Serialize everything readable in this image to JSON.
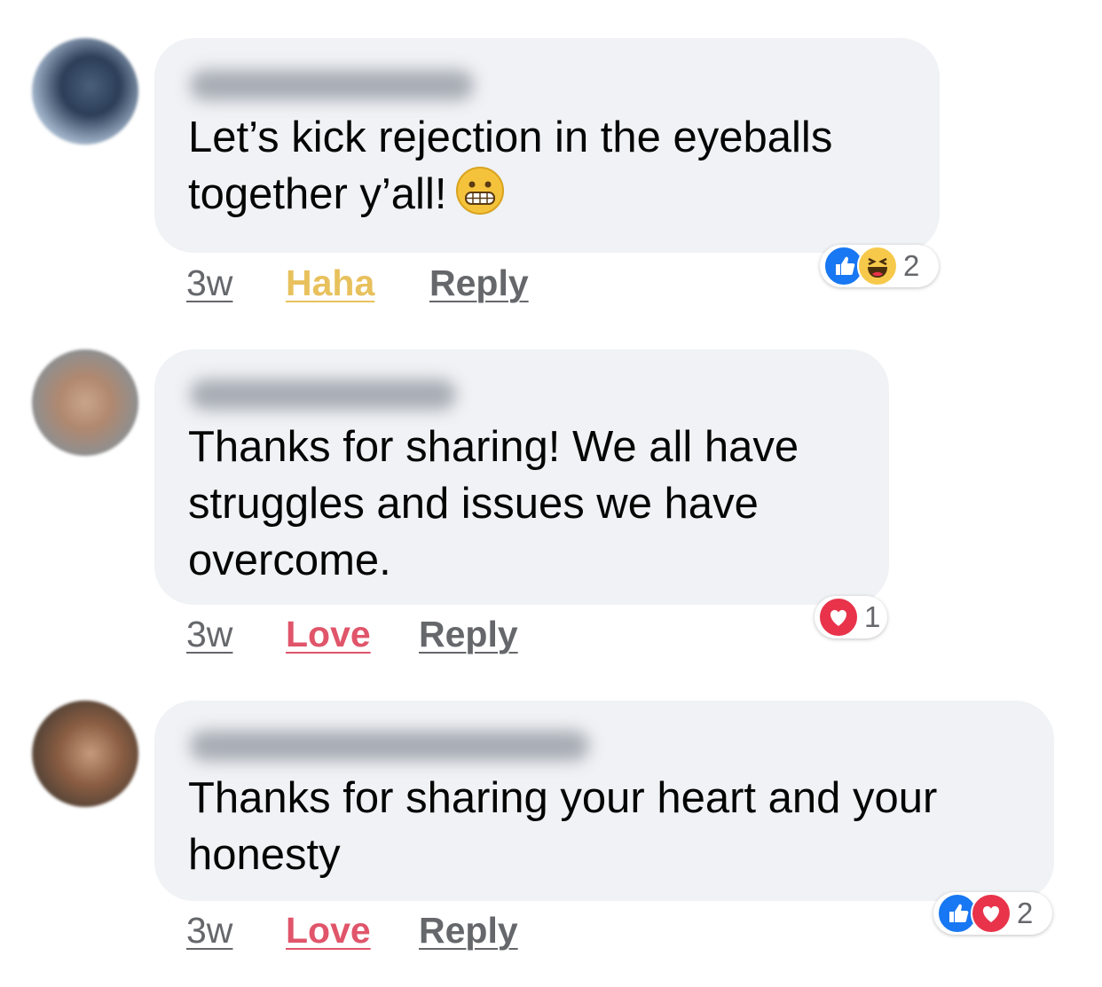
{
  "comments": [
    {
      "text_line1": "Let’s kick rejection in the eyeballs",
      "text_line2": "together y’all!",
      "inline_emoji": "grimacing-face",
      "time": "3w",
      "reaction_label": "Haha",
      "reply_label": "Reply",
      "reactions": [
        "like",
        "haha"
      ],
      "reaction_count": "2"
    },
    {
      "text": "Thanks for sharing! We all have struggles and issues we have overcome.",
      "time": "3w",
      "reaction_label": "Love",
      "reply_label": "Reply",
      "reactions": [
        "love"
      ],
      "reaction_count": "1"
    },
    {
      "text": "Thanks for sharing your heart and your honesty",
      "time": "3w",
      "reaction_label": "Love",
      "reply_label": "Reply",
      "reactions": [
        "like",
        "love"
      ],
      "reaction_count": "2"
    }
  ],
  "colors": {
    "bubble": "#f0f2f5",
    "haha": "#e8c15d",
    "love": "#e0556a",
    "meta": "#65676b",
    "like": "#1877f2"
  }
}
